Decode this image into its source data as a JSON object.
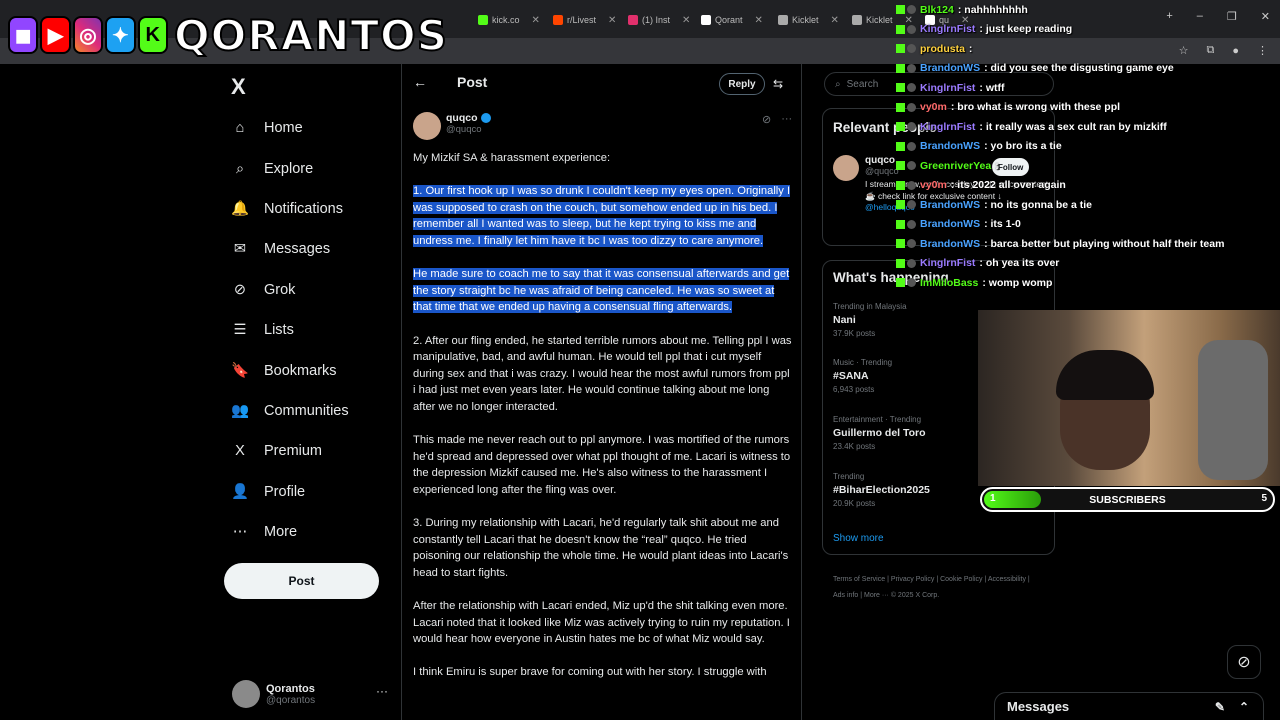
{
  "browser": {
    "tabs": [
      {
        "label": "kick.co",
        "color": "#53fc18"
      },
      {
        "label": "r/Livest",
        "color": "#ff4500"
      },
      {
        "label": "(1) Inst",
        "color": "#e1306c"
      },
      {
        "label": "Qorant",
        "color": "#ffffff"
      },
      {
        "label": "Kicklet",
        "color": "#aaaaaa"
      },
      {
        "label": "Kicklet",
        "color": "#aaaaaa"
      },
      {
        "label": "qu",
        "color": "#ffffff"
      }
    ],
    "new_tab": "+",
    "controls": {
      "minimize": "–",
      "maximize": "❐",
      "close": "✕"
    }
  },
  "stream_overlay": {
    "logo_text": "QORANTOS",
    "platform_icons": [
      "twitch-icon",
      "youtube-icon",
      "instagram-icon",
      "twitter-icon",
      "kick-icon"
    ]
  },
  "sidebar": {
    "logo": "X",
    "items": [
      {
        "label": "Home",
        "icon": "⌂"
      },
      {
        "label": "Explore",
        "icon": "⌕"
      },
      {
        "label": "Notifications",
        "icon": "🔔"
      },
      {
        "label": "Messages",
        "icon": "✉"
      },
      {
        "label": "Grok",
        "icon": "⊘"
      },
      {
        "label": "Lists",
        "icon": "☰"
      },
      {
        "label": "Bookmarks",
        "icon": "🔖"
      },
      {
        "label": "Communities",
        "icon": "👥"
      },
      {
        "label": "Premium",
        "icon": "X"
      },
      {
        "label": "Profile",
        "icon": "👤"
      },
      {
        "label": "More",
        "icon": "⋯"
      }
    ],
    "post_button": "Post",
    "account": {
      "name": "Qorantos",
      "handle": "@qorantos",
      "more": "···"
    }
  },
  "post": {
    "header_title": "Post",
    "reply_label": "Reply",
    "author_name": "quqco",
    "author_handle": "@quqco",
    "intro": "My Mizkif SA & harassment experience:",
    "paragraphs": [
      "1. Our first hook up I was so drunk I couldn't keep my eyes open. Originally I was supposed to crash on the couch, but somehow ended up in his bed. I remember all I wanted was to sleep, but he kept trying to kiss me and undress me. I finally let him have it bc I was too dizzy to care anymore.",
      "He made sure to coach me to say that it was consensual afterwards and get the story straight bc he was afraid of being canceled. He was so sweet at that time that we ended up having a consensual fling afterwards.",
      "2. After our fling ended, he started terrible rumors about me. Telling ppl I was manipulative, bad, and awful human. He would tell ppl that i cut myself during sex and that i was crazy. I would hear the most awful rumors from ppl i had just met even years later. He would continue talking about me long after we no longer interacted.",
      "This made me never reach out to ppl anymore. I was mortified of the rumors he'd spread and depressed over what ppl thought of me. Lacari is witness to the depression Mizkif caused me. He's also witness to the harassment I experienced long after the fling was over.",
      "3. During my relationship with Lacari, he'd regularly talk shit about me and constantly tell Lacari that he doesn't know the “real” quqco.  He tried poisoning our relationship the whole time. He would plant ideas into Lacari's head to start fights.",
      "After the relationship with Lacari ended, Miz up'd the shit talking even more. Lacari noted that it looked like Miz was actively trying to ruin my reputation. I would hear how everyone in Austin hates me bc of what Miz would say.",
      "I think Emiru is super brave for coming out with her story. I struggle with"
    ]
  },
  "right": {
    "search_placeholder": "Search",
    "relevant_title": "Relevant people",
    "relevant_person": {
      "name": "quqco",
      "handle": "@quqco",
      "bio": "I stream, draw, cook, cosplay, & do spicy content ☕ check link for exclusive content ↓",
      "link": "@helloquqco",
      "follow": "Follow"
    },
    "happening_title": "What's happening",
    "trends": [
      {
        "context": "Trending in Malaysia",
        "title": "Nani",
        "count": "37.9K posts"
      },
      {
        "context": "Music · Trending",
        "title": "#SANA",
        "count": "6,943 posts"
      },
      {
        "context": "Entertainment · Trending",
        "title": "Guillermo del Toro",
        "count": "23.4K posts"
      },
      {
        "context": "Trending",
        "title": "#BiharElection2025",
        "count": "20.9K posts"
      }
    ],
    "show_more": "Show more",
    "footer": "Terms of Service  |  Privacy Policy  |  Cookie Policy  |  Accessibility  |  Ads info  |  More ···  © 2025 X Corp."
  },
  "chat": [
    {
      "user": "Blk124",
      "color": "#53fc18",
      "msg": "nahhhhhhhh"
    },
    {
      "user": "KinglrnFist",
      "color": "#9b7bff",
      "msg": "just keep reading"
    },
    {
      "user": "produsta",
      "color": "#ffd23f",
      "msg": ""
    },
    {
      "user": "BrandonWS",
      "color": "#4aa3ff",
      "msg": "did you see the disgusting game eye"
    },
    {
      "user": "KinglrnFist",
      "color": "#9b7bff",
      "msg": "wtff"
    },
    {
      "user": "vy0m",
      "color": "#ff6b6b",
      "msg": "bro what is wrong with these ppl"
    },
    {
      "user": "KinglrnFist",
      "color": "#9b7bff",
      "msg": "it really was a sex cult ran by mizkiff"
    },
    {
      "user": "BrandonWS",
      "color": "#4aa3ff",
      "msg": "yo bro its a tie"
    },
    {
      "user": "GreenriverYea",
      "color": "#53fc18",
      "msg": ""
    },
    {
      "user": "vy0m",
      "color": "#ff6b6b",
      "msg": "its 2022 all over again"
    },
    {
      "user": "BrandonWS",
      "color": "#4aa3ff",
      "msg": "no its gonna be a tie"
    },
    {
      "user": "BrandonWS",
      "color": "#4aa3ff",
      "msg": "its 1-0"
    },
    {
      "user": "BrandonWS",
      "color": "#4aa3ff",
      "msg": "barca better but playing without half their team"
    },
    {
      "user": "KinglrnFist",
      "color": "#9b7bff",
      "msg": "oh yea its over"
    },
    {
      "user": "ImMiloBass",
      "color": "#53fc18",
      "msg": "womp womp"
    }
  ],
  "subscribers": {
    "label": "SUBSCRIBERS",
    "current": "1",
    "goal": "5",
    "progress": 0.2
  },
  "messages_drawer": {
    "title": "Messages"
  }
}
